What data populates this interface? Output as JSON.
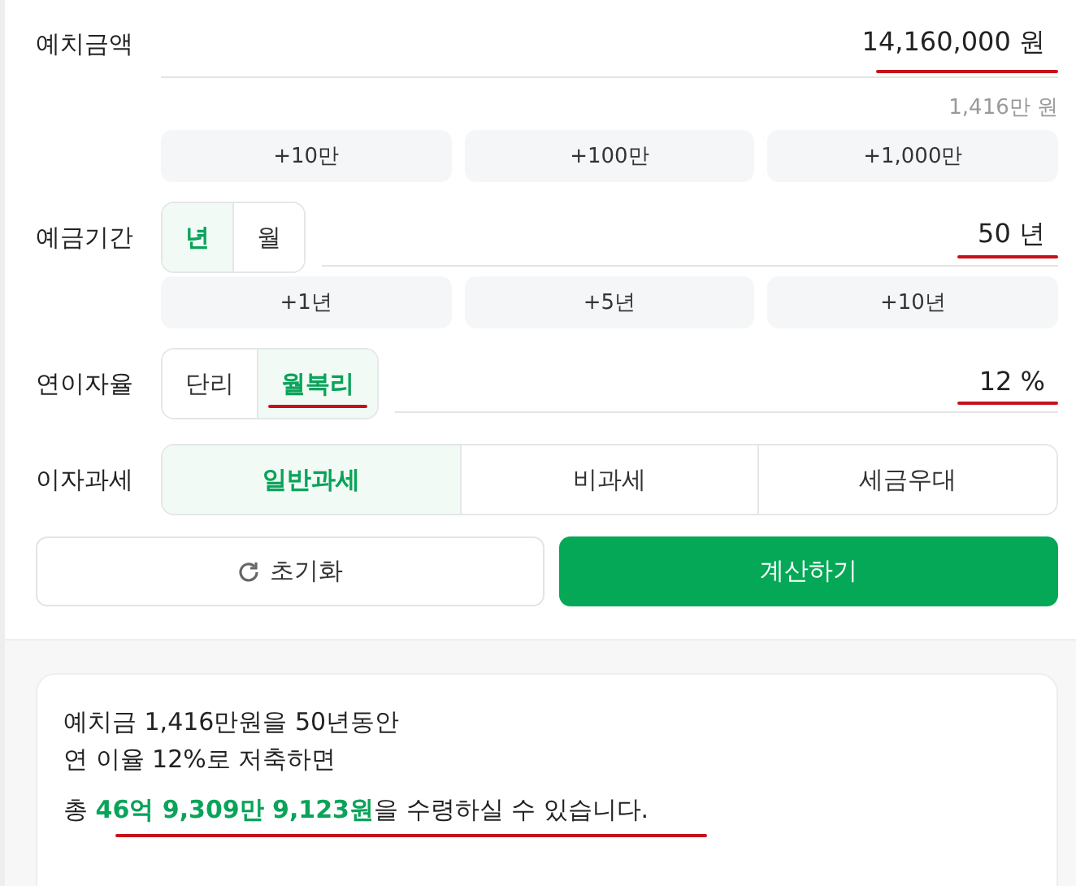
{
  "amount": {
    "label": "예치금액",
    "value": "14,160,000",
    "unit": "원",
    "marked": true,
    "hint": "1,416만 원",
    "quick": [
      "+10만",
      "+100만",
      "+1,000만"
    ]
  },
  "period": {
    "label": "예금기간",
    "units": [
      {
        "label": "년",
        "selected": true
      },
      {
        "label": "월",
        "selected": false
      }
    ],
    "value": "50",
    "unit": "년",
    "marked": true,
    "quick": [
      "+1년",
      "+5년",
      "+10년"
    ]
  },
  "rate": {
    "label": "연이자율",
    "modes": [
      {
        "label": "단리",
        "selected": false,
        "marked": false
      },
      {
        "label": "월복리",
        "selected": true,
        "marked": true
      }
    ],
    "value": "12",
    "unit": "%",
    "marked": true
  },
  "tax": {
    "label": "이자과세",
    "options": [
      {
        "label": "일반과세",
        "selected": true
      },
      {
        "label": "비과세",
        "selected": false
      },
      {
        "label": "세금우대",
        "selected": false
      }
    ]
  },
  "actions": {
    "reset": "초기화",
    "calculate": "계산하기"
  },
  "result": {
    "lines": [
      "예치금 1,416만원을 50년동안",
      "연 이율 12%로 저축하면"
    ],
    "summary": "총 **46억 9,309만 9,123원**을 수령하실 수 있습니다.",
    "marked": true
  }
}
